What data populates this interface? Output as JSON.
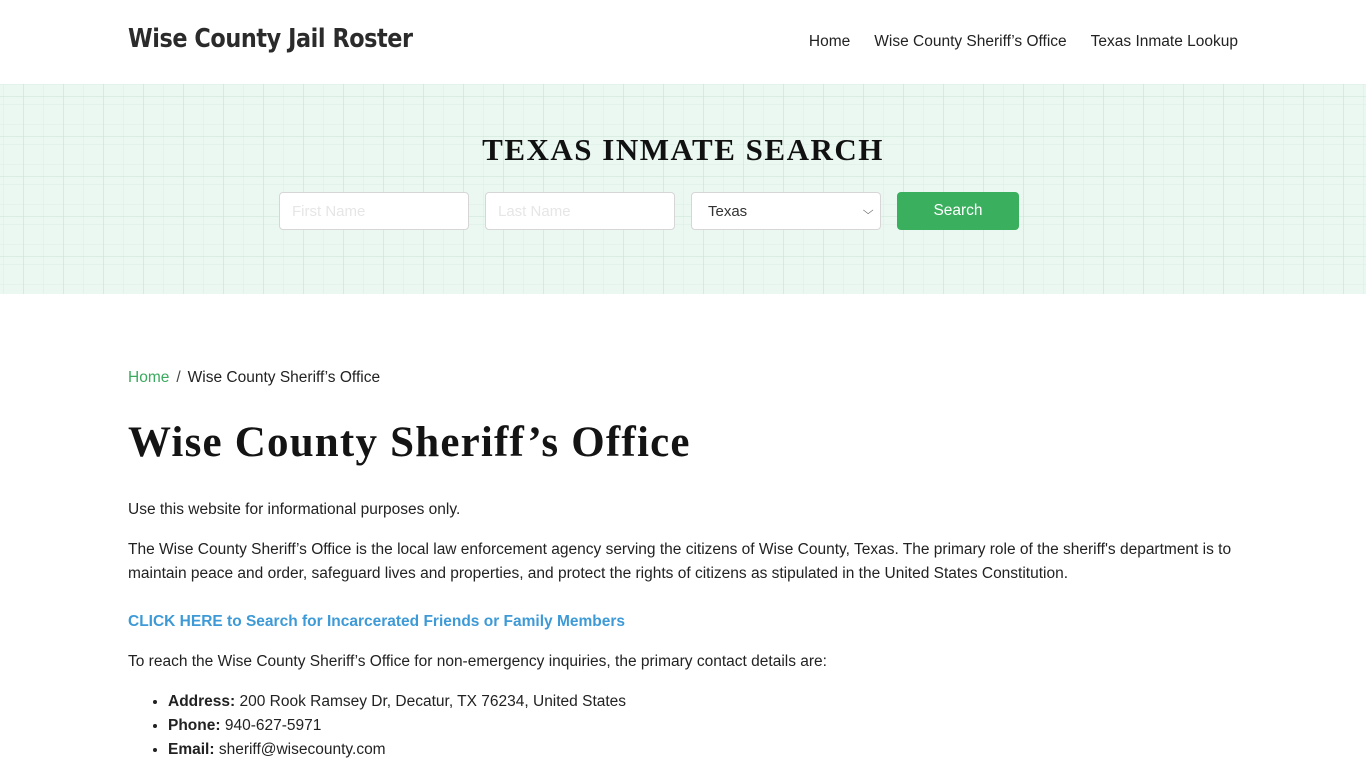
{
  "header": {
    "site_title": "Wise County Jail Roster",
    "nav": [
      {
        "label": "Home"
      },
      {
        "label": "Wise County Sheriff’s Office"
      },
      {
        "label": "Texas Inmate Lookup"
      }
    ]
  },
  "hero": {
    "title": "TEXAS INMATE SEARCH",
    "first_name_placeholder": "First Name",
    "last_name_placeholder": "Last Name",
    "state_selected": "Texas",
    "search_label": "Search",
    "accent_color": "#3aaf5e"
  },
  "breadcrumb": {
    "home": "Home",
    "separator": "/",
    "current": "Wise County Sheriff’s Office"
  },
  "main": {
    "title": "Wise County Sheriff’s Office",
    "disclaimer": "Use this website for informational purposes only.",
    "intro": "The Wise County Sheriff’s Office is the local law enforcement agency serving the citizens of Wise County, Texas. The primary role of the sheriff's department is to maintain peace and order, safeguard lives and properties, and protect the rights of citizens as stipulated in the United States Constitution.",
    "cta_link": "CLICK HERE to Search for Incarcerated Friends or Family Members",
    "contact_intro": "To reach the Wise County Sheriff’s Office for non-emergency inquiries, the primary contact details are:",
    "contacts": [
      {
        "label": "Address:",
        "value": " 200 Rook Ramsey Dr, Decatur, TX 76234, United States"
      },
      {
        "label": "Phone:",
        "value": " 940-627-5971"
      },
      {
        "label": "Email:",
        "value": " sheriff@wisecounty.com"
      }
    ]
  }
}
